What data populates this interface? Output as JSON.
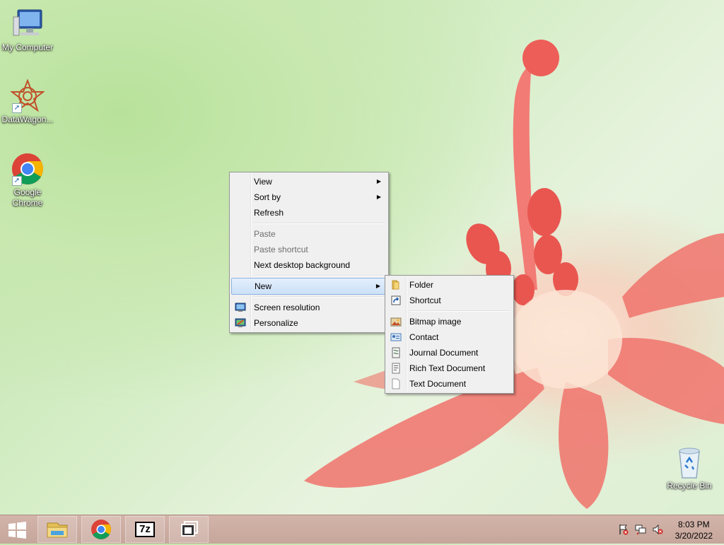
{
  "desktop": {
    "icons": [
      {
        "label": "My Computer"
      },
      {
        "label": "DataWagon..."
      },
      {
        "label": "Google Chrome"
      },
      {
        "label": "Recycle Bin"
      }
    ]
  },
  "context_menu": {
    "items": [
      {
        "label": "View",
        "submenu": true
      },
      {
        "label": "Sort by",
        "submenu": true
      },
      {
        "label": "Refresh"
      },
      {
        "label": "Paste",
        "disabled": true
      },
      {
        "label": "Paste shortcut",
        "disabled": true
      },
      {
        "label": "Next desktop background"
      },
      {
        "label": "New",
        "submenu": true,
        "highlighted": true
      },
      {
        "label": "Screen resolution",
        "icon": "display-icon"
      },
      {
        "label": "Personalize",
        "icon": "personalize-icon"
      }
    ]
  },
  "new_submenu": {
    "items": [
      {
        "label": "Folder",
        "icon": "folder-icon"
      },
      {
        "label": "Shortcut",
        "icon": "shortcut-icon"
      },
      {
        "label": "Bitmap image",
        "icon": "bitmap-icon"
      },
      {
        "label": "Contact",
        "icon": "contact-icon"
      },
      {
        "label": "Journal Document",
        "icon": "journal-icon"
      },
      {
        "label": "Rich Text Document",
        "icon": "rtf-icon"
      },
      {
        "label": "Text Document",
        "icon": "text-doc-icon"
      }
    ]
  },
  "taskbar": {
    "buttons": [
      "start-button",
      "file-explorer",
      "google-chrome",
      "7-zip",
      "switch-windows"
    ],
    "seven_zip_label": "7z",
    "clock": {
      "time": "8:03 PM",
      "date": "3/20/2022"
    }
  },
  "colors": {
    "menu_highlight": "#cbe0f8",
    "taskbar": "#c9a99e"
  }
}
